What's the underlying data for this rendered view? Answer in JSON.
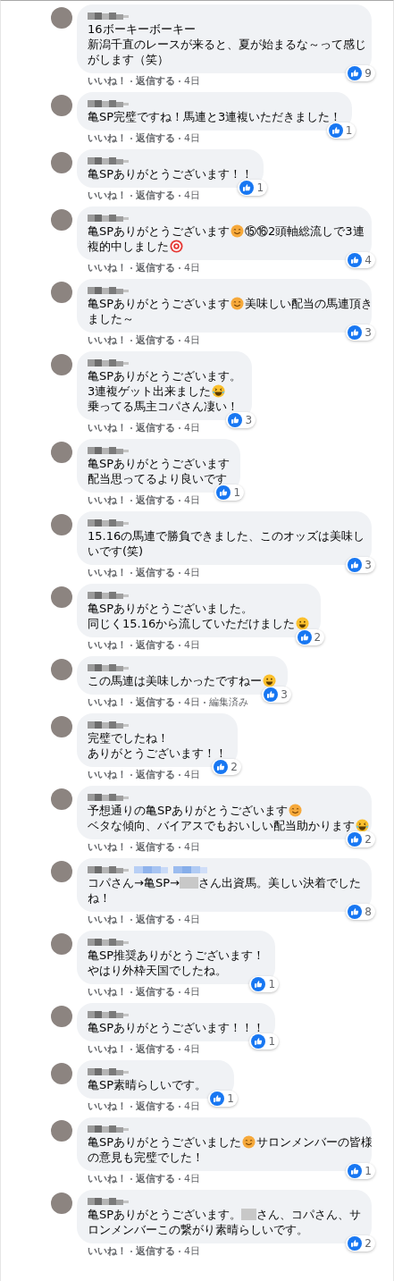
{
  "comments": [
    {
      "mention": false,
      "lines": [
        [
          {
            "kind": "text",
            "text": "16ボーキーボーキー"
          }
        ],
        [
          {
            "kind": "text",
            "text": "新潟千直のレースが来ると、夏が始まるな～って感じ"
          }
        ],
        [
          {
            "kind": "text",
            "text": "がします（笑）"
          }
        ]
      ],
      "likes": "9",
      "actions": {
        "like": "いいね！",
        "reply": "返信する",
        "time": "4日"
      }
    },
    {
      "mention": false,
      "lines": [
        [
          {
            "kind": "text",
            "text": "亀SP完璧ですね！馬連と3連複いただきました！"
          }
        ]
      ],
      "likes": "1",
      "actions": {
        "like": "いいね！",
        "reply": "返信する",
        "time": "4日"
      }
    },
    {
      "mention": false,
      "lines": [
        [
          {
            "kind": "text",
            "text": "亀SPありがとうございます！！"
          }
        ]
      ],
      "likes": "1",
      "actions": {
        "like": "いいね！",
        "reply": "返信する",
        "time": "4日"
      }
    },
    {
      "mention": false,
      "lines": [
        [
          {
            "kind": "text",
            "text": "亀SPありがとうございます"
          },
          {
            "kind": "smile"
          },
          {
            "kind": "text",
            "text": "⑮⑯2頭軸総流しで3連"
          }
        ],
        [
          {
            "kind": "text",
            "text": "複的中しました"
          },
          {
            "kind": "target"
          }
        ]
      ],
      "likes": "4",
      "actions": {
        "like": "いいね！",
        "reply": "返信する",
        "time": "4日"
      }
    },
    {
      "mention": false,
      "lines": [
        [
          {
            "kind": "text",
            "text": "亀SPありがとうございます"
          },
          {
            "kind": "smile"
          },
          {
            "kind": "text",
            "text": "美味しい配当の馬連頂き"
          }
        ],
        [
          {
            "kind": "text",
            "text": "ました～"
          }
        ]
      ],
      "likes": "3",
      "actions": {
        "like": "いいね！",
        "reply": "返信する",
        "time": "4日"
      }
    },
    {
      "mention": false,
      "lines": [
        [
          {
            "kind": "text",
            "text": "亀SPありがとうございます。"
          }
        ],
        [
          {
            "kind": "text",
            "text": "3連複ゲット出来ました"
          },
          {
            "kind": "laugh"
          }
        ],
        [
          {
            "kind": "text",
            "text": "乗ってる馬主コパさん凄い！"
          }
        ]
      ],
      "likes": "3",
      "actions": {
        "like": "いいね！",
        "reply": "返信する",
        "time": "4日"
      }
    },
    {
      "mention": false,
      "lines": [
        [
          {
            "kind": "text",
            "text": "亀SPありがとうございます"
          }
        ],
        [
          {
            "kind": "text",
            "text": "配当思ってるより良いです"
          }
        ]
      ],
      "likes": "1",
      "actions": {
        "like": "いいね！",
        "reply": "返信する",
        "time": "4日"
      }
    },
    {
      "mention": false,
      "lines": [
        [
          {
            "kind": "text",
            "text": "15.16の馬連で勝負できました、このオッズは美味し"
          }
        ],
        [
          {
            "kind": "text",
            "text": "いです(笑)"
          }
        ]
      ],
      "likes": "3",
      "actions": {
        "like": "いいね！",
        "reply": "返信する",
        "time": "4日"
      }
    },
    {
      "mention": false,
      "lines": [
        [
          {
            "kind": "text",
            "text": "亀SPありがとうございました。"
          }
        ],
        [
          {
            "kind": "text",
            "text": "同じく15.16から流していただけました"
          },
          {
            "kind": "grin"
          }
        ]
      ],
      "likes": "2",
      "actions": {
        "like": "いいね！",
        "reply": "返信する",
        "time": "4日"
      }
    },
    {
      "mention": false,
      "lines": [
        [
          {
            "kind": "text",
            "text": "この馬連は美味しかったですねー"
          },
          {
            "kind": "grin"
          }
        ]
      ],
      "likes": "3",
      "actions": {
        "like": "いいね！",
        "reply": "返信する",
        "time": "4日",
        "edited": "編集済み"
      }
    },
    {
      "mention": false,
      "lines": [
        [
          {
            "kind": "text",
            "text": "完璧でしたね！"
          }
        ],
        [
          {
            "kind": "text",
            "text": "ありがとうございます！！"
          }
        ]
      ],
      "likes": "2",
      "actions": {
        "like": "いいね！",
        "reply": "返信する",
        "time": "4日"
      }
    },
    {
      "mention": false,
      "lines": [
        [
          {
            "kind": "text",
            "text": "予想通りの亀SPありがとうございます"
          },
          {
            "kind": "smile"
          }
        ],
        [
          {
            "kind": "text",
            "text": "ベタな傾向、バイアスでもおいしい配当助かります"
          },
          {
            "kind": "laugh"
          }
        ]
      ],
      "likes": "2",
      "actions": {
        "like": "いいね！",
        "reply": "返信する",
        "time": "4日"
      }
    },
    {
      "mention": true,
      "lines": [
        [
          {
            "kind": "text",
            "text": "コパさん→亀SP→"
          },
          {
            "kind": "redacted"
          },
          {
            "kind": "text",
            "text": "さん出資馬。美しい決着でした"
          }
        ],
        [
          {
            "kind": "text",
            "text": "ね！"
          }
        ]
      ],
      "likes": "8",
      "actions": {
        "like": "いいね！",
        "reply": "返信する",
        "time": "4日"
      }
    },
    {
      "mention": false,
      "lines": [
        [
          {
            "kind": "text",
            "text": "亀SP推奨ありがとうございます！"
          }
        ],
        [
          {
            "kind": "text",
            "text": "やはり外枠天国でしたね。"
          }
        ]
      ],
      "likes": "1",
      "actions": {
        "like": "いいね！",
        "reply": "返信する",
        "time": "4日"
      }
    },
    {
      "mention": false,
      "lines": [
        [
          {
            "kind": "text",
            "text": "亀SPありがとうございます！！！"
          }
        ]
      ],
      "likes": "1",
      "actions": {
        "like": "いいね！",
        "reply": "返信する",
        "time": "4日"
      }
    },
    {
      "mention": false,
      "lines": [
        [
          {
            "kind": "text",
            "text": "亀SP素晴らしいです。"
          }
        ]
      ],
      "likes": "1",
      "actions": {
        "like": "いいね！",
        "reply": "返信する",
        "time": "4日"
      }
    },
    {
      "mention": false,
      "lines": [
        [
          {
            "kind": "text",
            "text": "亀SPありがとうございました"
          },
          {
            "kind": "smile"
          },
          {
            "kind": "text",
            "text": "サロンメンバーの皆様"
          }
        ],
        [
          {
            "kind": "text",
            "text": "の意見も完璧でした！"
          }
        ]
      ],
      "likes": "1",
      "actions": {
        "like": "いいね！",
        "reply": "返信する",
        "time": "4日"
      }
    },
    {
      "mention": false,
      "lines": [
        [
          {
            "kind": "text",
            "text": "亀SPありがとうございます。"
          },
          {
            "kind": "redacted"
          },
          {
            "kind": "text",
            "text": "さん、コパさん、サ"
          }
        ],
        [
          {
            "kind": "text",
            "text": "ロンメンバーこの繋がり素晴らしいです。"
          }
        ]
      ],
      "likes": "2",
      "actions": {
        "like": "いいね！",
        "reply": "返信する",
        "time": "4日"
      }
    }
  ]
}
